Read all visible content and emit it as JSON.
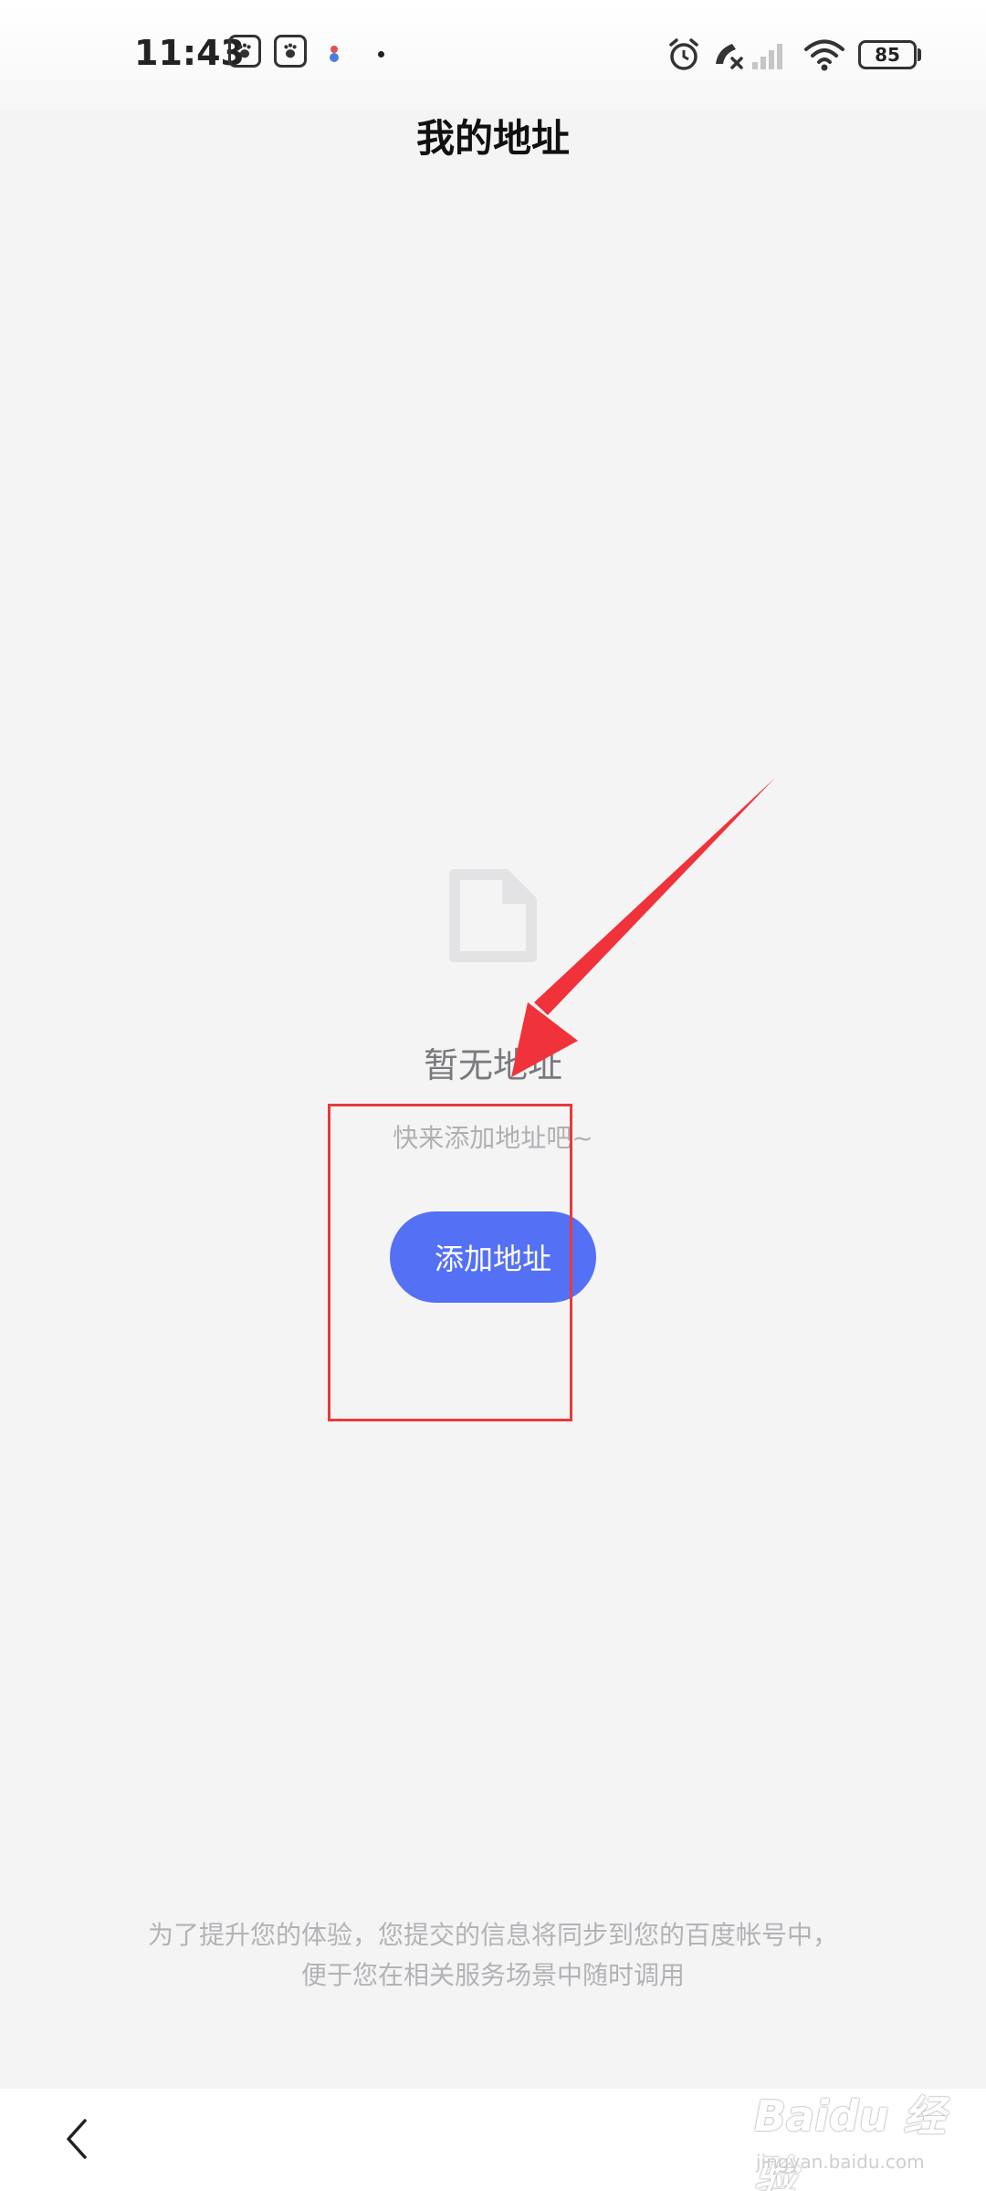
{
  "status_bar": {
    "time": "11:43",
    "battery": "85",
    "icons": [
      "baidu-paw-icon",
      "baidu-paw-icon",
      "app-icon",
      "dot",
      "alarm-icon",
      "call-muted-icon",
      "signal-icon",
      "wifi-icon",
      "battery-icon"
    ]
  },
  "header": {
    "title": "我的地址"
  },
  "empty_state": {
    "icon": "document-icon",
    "title": "暂无地址",
    "subtitle": "快来添加地址吧~",
    "button_label": "添加地址"
  },
  "footer": {
    "line1": "为了提升您的体验，您提交的信息将同步到您的百度帐号中，",
    "line2": "便于您在相关服务场景中随时调用"
  },
  "nav": {
    "back_icon": "chevron-left-icon"
  },
  "watermark": {
    "brand": "Baidu 经验",
    "url": "jingyan.baidu.com"
  },
  "colors": {
    "background": "#f4f4f5",
    "accent": "#5470f4",
    "annotation": "#e83a3a"
  }
}
